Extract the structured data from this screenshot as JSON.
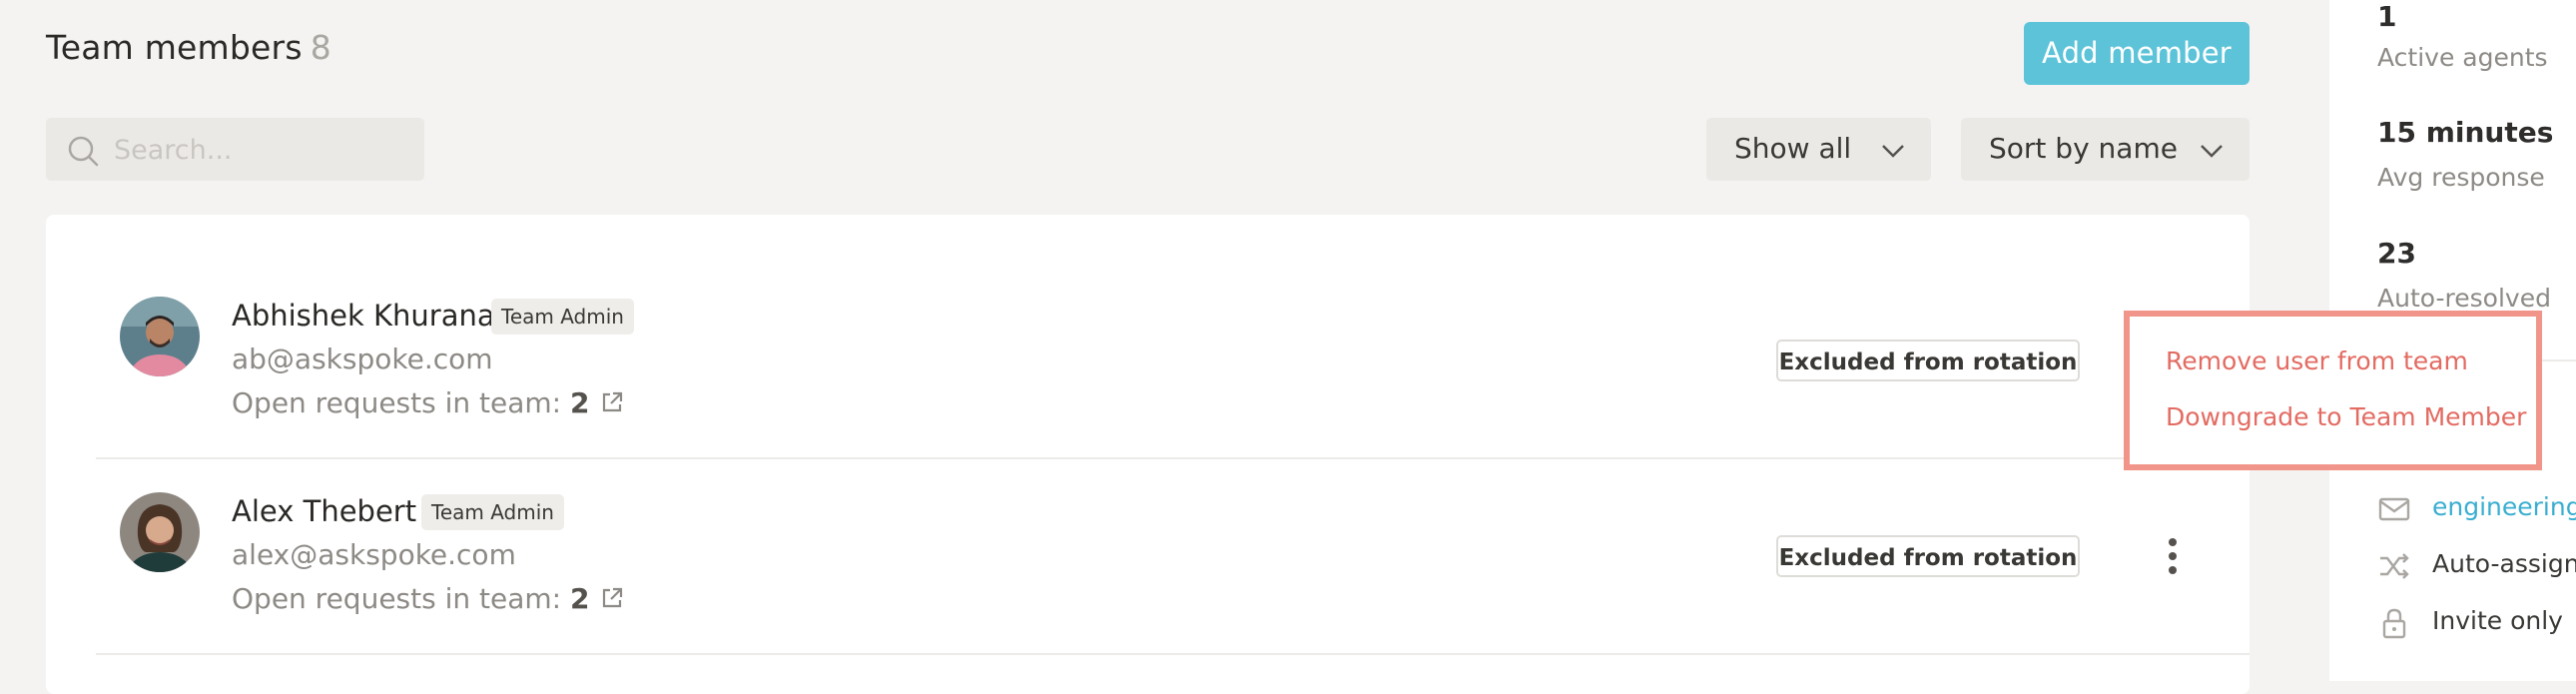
{
  "header": {
    "title": "Team members",
    "member_count": "8",
    "add_button_label": "Add member"
  },
  "search": {
    "placeholder": "Search..."
  },
  "filters": {
    "show_value": "Show all",
    "sort_value": "Sort by name"
  },
  "members": [
    {
      "name": "Abhishek Khurana",
      "role": "Team Admin",
      "email": "ab@askspoke.com",
      "open_requests_label": "Open requests in team:",
      "open_requests_count": "2",
      "rotation_status": "Excluded from rotation"
    },
    {
      "name": "Alex Thebert",
      "role": "Team Admin",
      "email": "alex@askspoke.com",
      "open_requests_label": "Open requests in team:",
      "open_requests_count": "2",
      "rotation_status": "Excluded from rotation"
    }
  ],
  "context_menu": {
    "items": [
      "Remove user from team",
      "Downgrade to Team Member"
    ]
  },
  "sidebar": {
    "stats": [
      {
        "value": "1",
        "label": "Active agents"
      },
      {
        "value": "15 minutes",
        "label": "Avg response"
      },
      {
        "value": "23",
        "label": "Auto-resolved"
      }
    ],
    "settings": [
      {
        "icon": "mail-icon",
        "text": "engineering@"
      },
      {
        "icon": "shuffle-icon",
        "text": "Auto-assign"
      },
      {
        "icon": "lock-icon",
        "text": "Invite only"
      }
    ]
  },
  "colors": {
    "accent": "#5cc3d9",
    "danger": "#e36b62",
    "menu_highlight": "#f1958a",
    "link": "#3aaed0"
  }
}
